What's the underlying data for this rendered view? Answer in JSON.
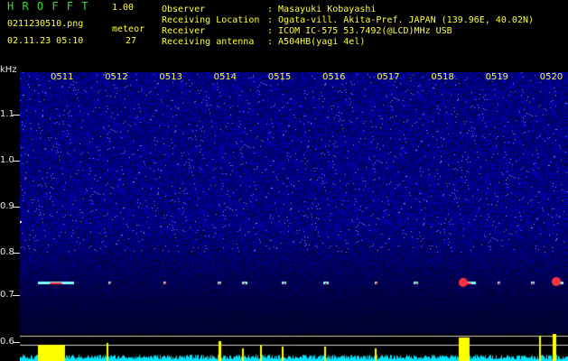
{
  "app": {
    "logo_text": "H R O F F T",
    "version": "1.00",
    "filename": "0211230510.png",
    "datetime": "02.11.23 05:10",
    "meteor_label": "meteor",
    "meteor_count": "27"
  },
  "info": {
    "observer_label": "Observer",
    "observer_value": ": Masayuki Kobayashi",
    "location_label": "Receiving Location",
    "location_value": ": Ogata-vill. Akita-Pref. JAPAN (139.96E, 40.02N)",
    "receiver_label": "Receiver",
    "receiver_value": ": ICOM IC-575 53.7492(@LCD)MHz USB",
    "antenna_label": "Receiving antenna",
    "antenna_value": ": A504HB(yagi 4el)"
  },
  "axis": {
    "unit": "kHz",
    "freq_ticks": [
      "1.1",
      "1.0",
      "0.9",
      "0.8",
      "0.7",
      "0.6"
    ],
    "minute_labels": [
      "0511",
      "0512",
      "0513",
      "0514",
      "0515",
      "0516",
      "0517",
      "0518",
      "0519",
      "0520"
    ]
  },
  "colors": {
    "background": "#000000",
    "header_green": "#33dd33",
    "header_yellow": "#ffff33",
    "noise": "#2a2aff",
    "meteor_core": "#ff3040",
    "meter_yellow": "#ffff00",
    "meter_cyan": "#00e5ff"
  }
}
